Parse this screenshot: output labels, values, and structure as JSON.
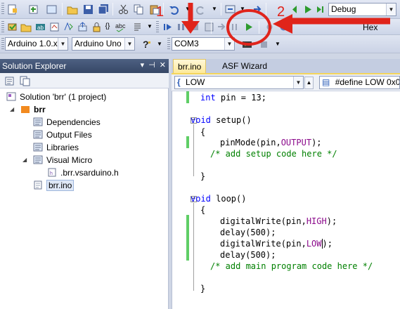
{
  "toolbar_row1": {
    "configuration": "Debug",
    "icons": [
      "new-project-icon",
      "add-item-icon",
      "open-file-icon",
      "save-icon",
      "save-all-icon",
      "cut-icon",
      "copy-icon",
      "paste-icon",
      "undo-icon",
      "redo-icon",
      "navigate-back-icon",
      "navigate-forward-icon",
      "start-debug-icon"
    ]
  },
  "toolbar_row2": {
    "hex_label": "Hex",
    "icons": [
      "build-icon",
      "open-icon",
      "board-icon",
      "serial-icon",
      "compile-icon",
      "upload-icon",
      "spell-icon",
      "comment-icon",
      "step-into-icon",
      "break-icon",
      "stop-icon",
      "continue-icon",
      "play-icon"
    ]
  },
  "toolbar_row3": {
    "ide_version": "Arduino 1.0.x",
    "board": "Arduino Uno",
    "port": "COM3"
  },
  "annotations": {
    "label_1": "1",
    "label_2": "2"
  },
  "solution_explorer": {
    "title": "Solution Explorer",
    "tree": {
      "solution": "Solution 'brr' (1 project)",
      "project": "brr",
      "items": [
        "Dependencies",
        "Output Files",
        "Libraries",
        "Visual Micro"
      ],
      "visual_micro_child": ".brr.vsarduino.h",
      "selected_file": "brr.ino"
    }
  },
  "editor": {
    "tabs": [
      "brr.ino",
      "ASF Wizard"
    ],
    "member_dropdown": "LOW",
    "define_dropdown": "#define LOW 0x0",
    "code": {
      "line1_type": "int",
      "line1_rest": " pin = 13;",
      "setup_kw": "void",
      "setup_name": " setup()",
      "open_brace": "{",
      "close_brace": "}",
      "pinmode_pre": "pinMode(pin,",
      "pinmode_const": "OUTPUT",
      "pinmode_post": ");",
      "setup_comment": "/* add setup code here */",
      "loop_kw": "void",
      "loop_name": " loop()",
      "dw_pre": "digitalWrite(pin,",
      "const_high": "HIGH",
      "const_low": "LOW",
      "dw_post": ");",
      "delay_line": "delay(500);",
      "loop_comment": "/* add main program code here */"
    }
  }
}
